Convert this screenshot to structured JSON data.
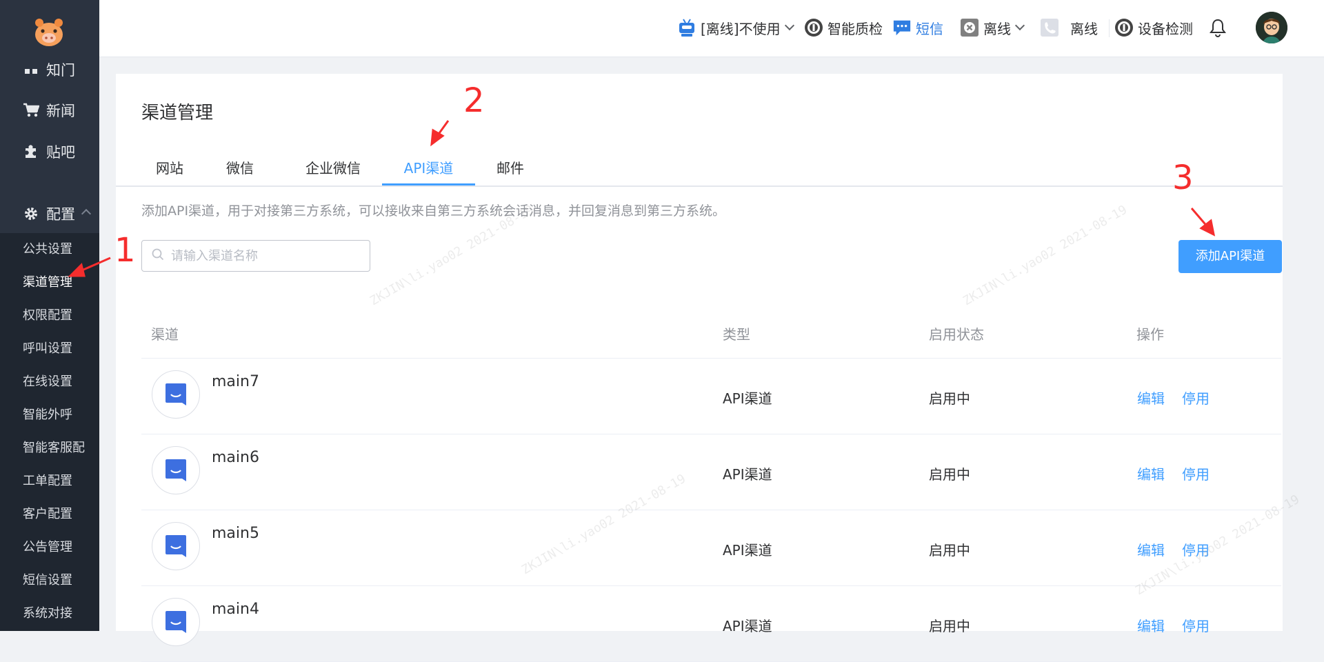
{
  "sidebar": {
    "main_items": [
      {
        "label": "知门",
        "icon": "app-icon"
      },
      {
        "label": "新闻",
        "icon": "cart-icon"
      },
      {
        "label": "贴吧",
        "icon": "puzzle-icon"
      },
      {
        "label": "配置",
        "icon": "gear-icon"
      }
    ],
    "sub_items": [
      "公共设置",
      "渠道管理",
      "权限配置",
      "呼叫设置",
      "在线设置",
      "智能外呼",
      "智能客服配",
      "工单配置",
      "客户配置",
      "公告管理",
      "短信设置",
      "系统对接"
    ]
  },
  "header": {
    "status_label": "[离线]不使用",
    "quality_label": "智能质检",
    "sms_label": "短信",
    "offline_label": "离线",
    "phone_offline_label": "离线",
    "device_check_label": "设备检测"
  },
  "main": {
    "title": "渠道管理",
    "tabs": [
      "网站",
      "微信",
      "企业微信",
      "API渠道",
      "邮件"
    ],
    "description": "添加API渠道，用于对接第三方系统，可以接收来自第三方系统会话消息，并回复消息到第三方系统。",
    "search_placeholder": "请输入渠道名称",
    "add_button": "添加API渠道",
    "columns": [
      "渠道",
      "类型",
      "启用状态",
      "操作"
    ],
    "rows": [
      {
        "name": "main7",
        "type": "API渠道",
        "status": "启用中",
        "edit": "编辑",
        "disable": "停用"
      },
      {
        "name": "main6",
        "type": "API渠道",
        "status": "启用中",
        "edit": "编辑",
        "disable": "停用"
      },
      {
        "name": "main5",
        "type": "API渠道",
        "status": "启用中",
        "edit": "编辑",
        "disable": "停用"
      },
      {
        "name": "main4",
        "type": "API渠道",
        "status": "启用中",
        "edit": "编辑",
        "disable": "停用"
      }
    ]
  },
  "annotations": [
    "1",
    "2",
    "3"
  ],
  "watermark": "ZKJIN\\li.yao02  2021-08-19",
  "colors": {
    "accent": "#409eff",
    "sidebar": "#2b3340",
    "annotation": "#f52d2d"
  }
}
